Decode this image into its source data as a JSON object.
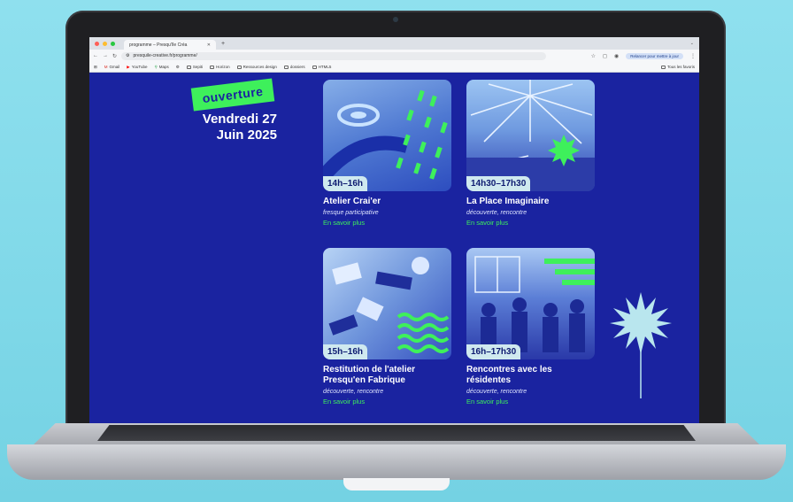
{
  "browser": {
    "tab_title": "programme – Presqu'île Créa",
    "url": "presquile-creative.fr/programme/",
    "relaunch_label": "Relancer pour mettre à jour",
    "bookmarks": [
      "Gmail",
      "YouTube",
      "Maps",
      "",
      "Sepiti",
      "Horizon",
      "Ressources design",
      "dossiers",
      "HTML5"
    ],
    "all_bookmarks": "Tous les favoris"
  },
  "page": {
    "badge": "ouverture",
    "date_line1": "Vendredi 27",
    "date_line2": "Juin 2025"
  },
  "events": [
    {
      "time": "14h–16h",
      "title": "Atelier Crai'er",
      "subtitle": "fresque participative",
      "link": "En savoir plus"
    },
    {
      "time": "14h30–17h30",
      "title": "La Place Imaginaire",
      "subtitle": "découverte, rencontre",
      "link": "En savoir plus"
    },
    {
      "time": "15h–16h",
      "title": "Restitution de l'atelier Presqu'en Fabrique",
      "subtitle": "découverte, rencontre",
      "link": "En savoir plus"
    },
    {
      "time": "16h–17h30",
      "title": "Rencontres avec les résidentes",
      "subtitle": "découverte, rencontre",
      "link": "En savoir plus"
    }
  ],
  "colors": {
    "page_bg": "#1a23a0",
    "accent_green": "#3ef05b",
    "time_badge_bg": "#cfe9ef",
    "star_light": "#b9e6ee"
  },
  "icons": [
    "back-icon",
    "forward-icon",
    "reload-icon",
    "site-info-icon",
    "star-icon",
    "extension-icon",
    "profile-icon",
    "apps-icon",
    "folder-icon"
  ]
}
